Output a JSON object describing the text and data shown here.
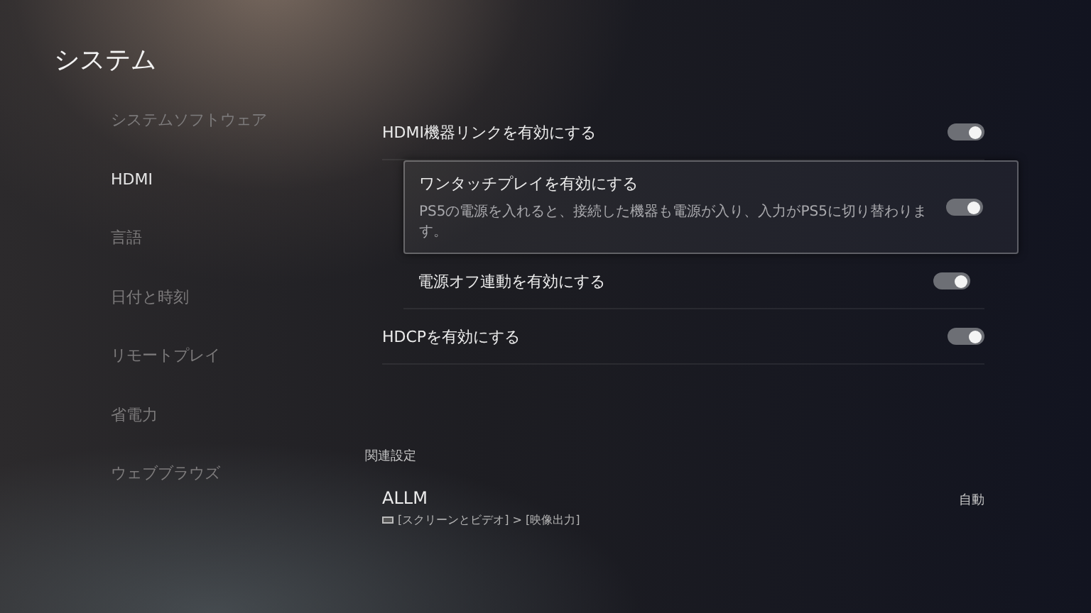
{
  "title": "システム",
  "sidebar": {
    "items": [
      {
        "label": "システムソフトウェア",
        "selected": false
      },
      {
        "label": "HDMI",
        "selected": true
      },
      {
        "label": "言語",
        "selected": false
      },
      {
        "label": "日付と時刻",
        "selected": false
      },
      {
        "label": "リモートプレイ",
        "selected": false
      },
      {
        "label": "省電力",
        "selected": false
      },
      {
        "label": "ウェブブラウズ",
        "selected": false
      }
    ]
  },
  "settings": [
    {
      "label": "HDMI機器リンクを有効にする",
      "on": true,
      "children": [
        {
          "label": "ワンタッチプレイを有効にする",
          "on": true,
          "focused": true,
          "description": "PS5の電源を入れると、接続した機器も電源が入り、入力がPS5に切り替わります。"
        },
        {
          "label": "電源オフ連動を有効にする",
          "on": true,
          "focused": false
        }
      ]
    },
    {
      "label": "HDCPを有効にする",
      "on": true
    }
  ],
  "related": {
    "heading": "関連設定",
    "items": [
      {
        "label": "ALLM",
        "value": "自動",
        "path": "[スクリーンとビデオ] > [映像出力]"
      }
    ]
  }
}
